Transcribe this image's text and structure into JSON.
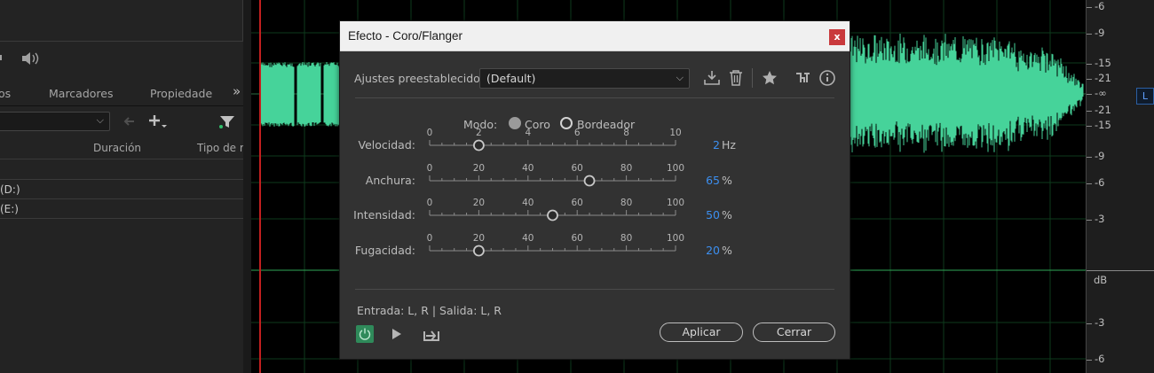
{
  "left_panel": {
    "tabs": [
      {
        "label": "os"
      },
      {
        "label": "Marcadores"
      },
      {
        "label": "Propiedade"
      }
    ],
    "more_label": "»",
    "columns": [
      "Duración",
      "Tipo de r"
    ],
    "rows": [
      "(D:)",
      "(E:)"
    ]
  },
  "ruler": {
    "labels": [
      "-6",
      "-9",
      "-15",
      "-21",
      "-∞",
      "-21",
      "-15",
      "-9",
      "-6",
      "-3",
      "dB",
      "-3",
      "-6"
    ],
    "channel_badge": "L"
  },
  "dialog": {
    "title": "Efecto - Coro/Flanger",
    "close_label": "x",
    "preset_label": "Ajustes preestablecidos:",
    "preset_value": "(Default)",
    "mode_label": "Modo:",
    "mode_options": [
      "Coro",
      "Bordeador"
    ],
    "mode_selected": "Coro",
    "sliders": [
      {
        "label": "Velocidad:",
        "ticks": [
          "0",
          "2",
          "4",
          "6",
          "8",
          "10"
        ],
        "min": 0,
        "max": 10,
        "value": 2,
        "value_text": "2",
        "unit": "Hz"
      },
      {
        "label": "Anchura:",
        "ticks": [
          "0",
          "20",
          "40",
          "60",
          "80",
          "100"
        ],
        "min": 0,
        "max": 100,
        "value": 65,
        "value_text": "65",
        "unit": "%"
      },
      {
        "label": "Intensidad:",
        "ticks": [
          "0",
          "20",
          "40",
          "60",
          "80",
          "100"
        ],
        "min": 0,
        "max": 100,
        "value": 50,
        "value_text": "50",
        "unit": "%"
      },
      {
        "label": "Fugacidad:",
        "ticks": [
          "0",
          "20",
          "40",
          "60",
          "80",
          "100"
        ],
        "min": 0,
        "max": 100,
        "value": 20,
        "value_text": "20",
        "unit": "%"
      }
    ],
    "io_text": "Entrada: L, R | Salida: L, R",
    "apply_label": "Aplicar",
    "close_button_label": "Cerrar"
  },
  "colors": {
    "waveform": "#46d39a",
    "accent_value": "#3c8ff0",
    "power_on": "#2f8a5a",
    "playhead": "#c21f1f"
  }
}
